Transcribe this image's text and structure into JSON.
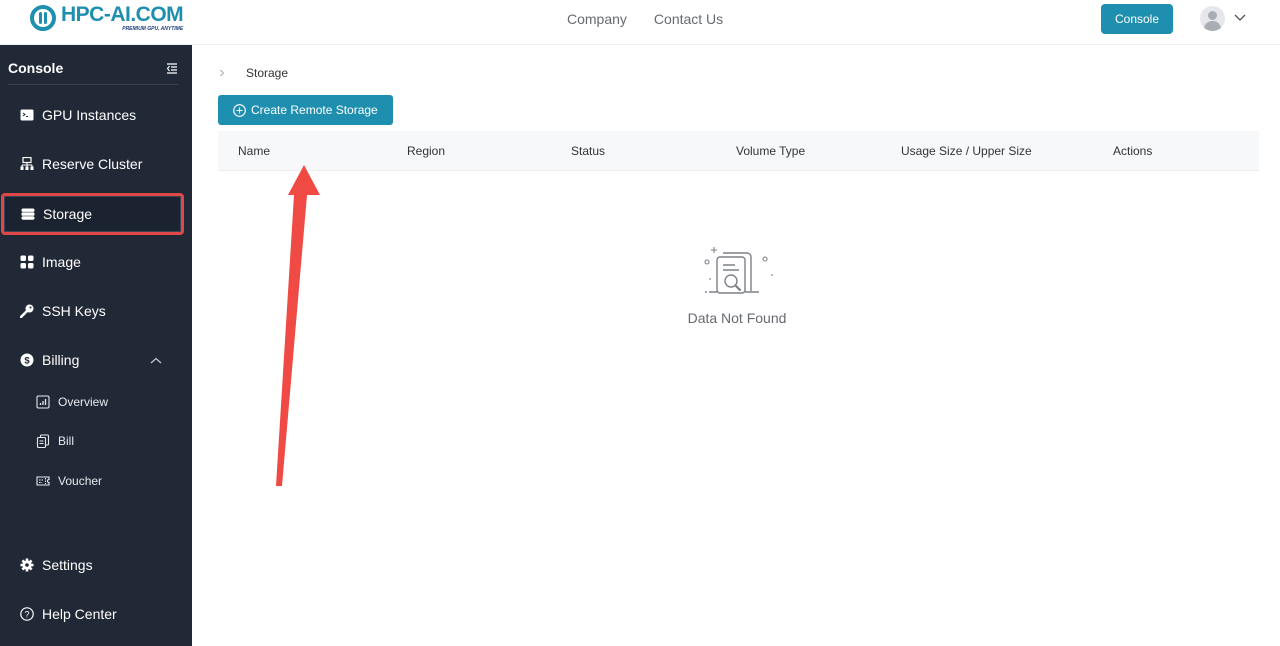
{
  "header": {
    "logo_name": "HPC-AI.COM",
    "logo_tagline": "PREMIUM GPU, ANYTIME",
    "nav": [
      "Company",
      "Contact Us"
    ],
    "console_button": "Console",
    "brand_color": "#1f8fb0"
  },
  "sidebar": {
    "title": "Console",
    "items": [
      {
        "label": "GPU Instances",
        "icon": "terminal-icon"
      },
      {
        "label": "Reserve Cluster",
        "icon": "cluster-icon"
      },
      {
        "label": "Storage",
        "icon": "storage-icon",
        "active": true
      },
      {
        "label": "Image",
        "icon": "grid-icon"
      },
      {
        "label": "SSH Keys",
        "icon": "key-icon"
      },
      {
        "label": "Billing",
        "icon": "dollar-icon",
        "expanded": true
      }
    ],
    "billing_sub": [
      {
        "label": "Overview",
        "icon": "chart-icon"
      },
      {
        "label": "Bill",
        "icon": "clipboard-icon"
      },
      {
        "label": "Voucher",
        "icon": "ticket-icon"
      }
    ],
    "bottom": [
      {
        "label": "Settings",
        "icon": "gear-icon"
      },
      {
        "label": "Help Center",
        "icon": "help-icon"
      }
    ]
  },
  "main": {
    "breadcrumb": "Storage",
    "create_button": "Create Remote Storage",
    "columns": [
      "Name",
      "Region",
      "Status",
      "Volume Type",
      "Usage Size / Upper Size",
      "Actions"
    ],
    "rows": [],
    "empty_text": "Data Not Found"
  },
  "annotation": {
    "highlight_color": "#e04848",
    "arrow_color": "#f04a45"
  }
}
